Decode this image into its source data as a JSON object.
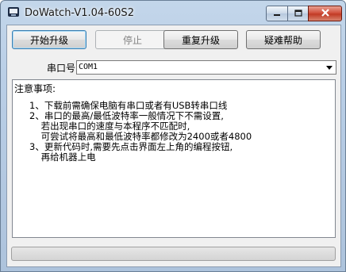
{
  "window": {
    "title": "DoWatch-V1.04-60S2"
  },
  "toolbar": {
    "start_upgrade": "开始升级",
    "stop": "停止",
    "repeat_upgrade": "重复升级",
    "help": "疑难帮助"
  },
  "port": {
    "label": "串口号",
    "value": "COM1"
  },
  "notes": {
    "title": "注意事项:",
    "lines": [
      "1、下载前需确保电脑有串口或者有USB转串口线",
      "2、串口的最高/最低波特率一般情况下不需设置,",
      "    若出现串口的速度与本程序不匹配时,",
      "    可尝试将最高和最低波特率都修改为2400或者4800",
      "3、更新代码时,需要先点击界面左上角的编程按钮,",
      "    再给机器上电"
    ]
  },
  "progress": {
    "fraction": 0
  },
  "icons": {
    "app": "app-icon",
    "minimize": "minimize-icon",
    "maximize": "maximize-icon",
    "close": "close-icon",
    "dropdown": "chevron-down-icon"
  },
  "colors": {
    "close_button": "#c13a24",
    "focus_border": "#3c7fb1"
  }
}
